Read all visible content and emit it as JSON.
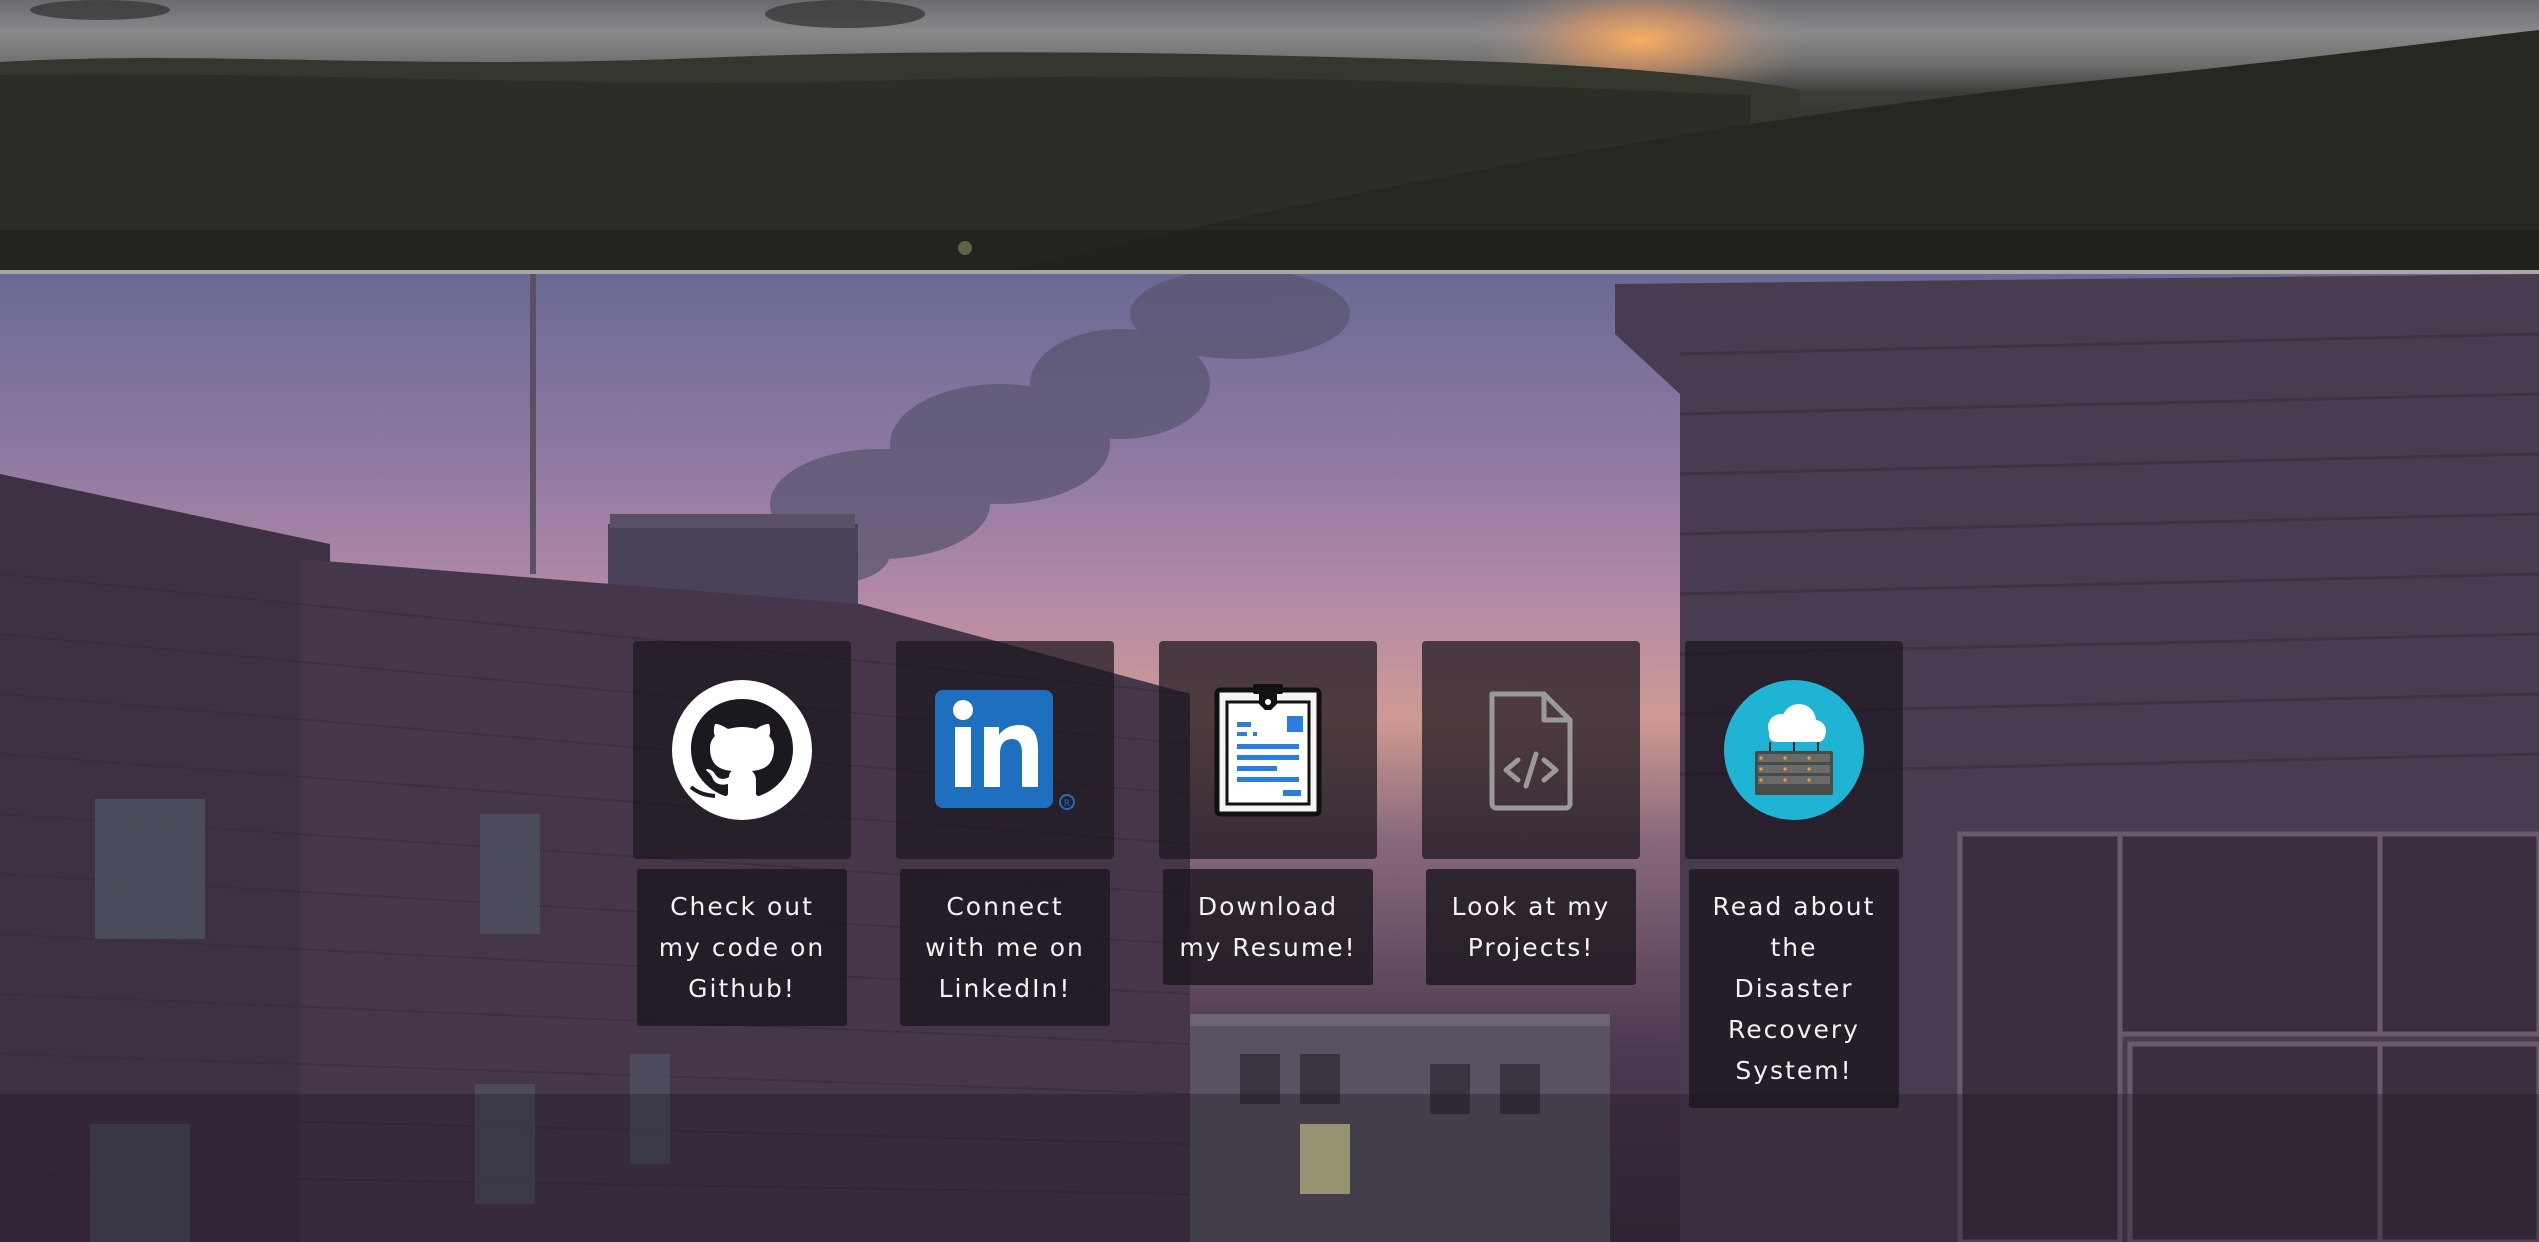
{
  "cards": [
    {
      "icon": "github-icon",
      "label": "Check out\nmy code on\nGithub!"
    },
    {
      "icon": "linkedin-icon",
      "label": "Connect\nwith me on\nLinkedIn!"
    },
    {
      "icon": "resume-icon",
      "label": "Download\nmy Resume!"
    },
    {
      "icon": "code-file-icon",
      "label": "Look at my\nProjects!"
    },
    {
      "icon": "cloud-server-icon",
      "label": "Read about\nthe\nDisaster\nRecovery\nSystem!"
    }
  ],
  "colors": {
    "linkedin_blue": "#1f6fc1",
    "resume_blue": "#2b7de0",
    "cloud_teal": "#20b4d4"
  }
}
